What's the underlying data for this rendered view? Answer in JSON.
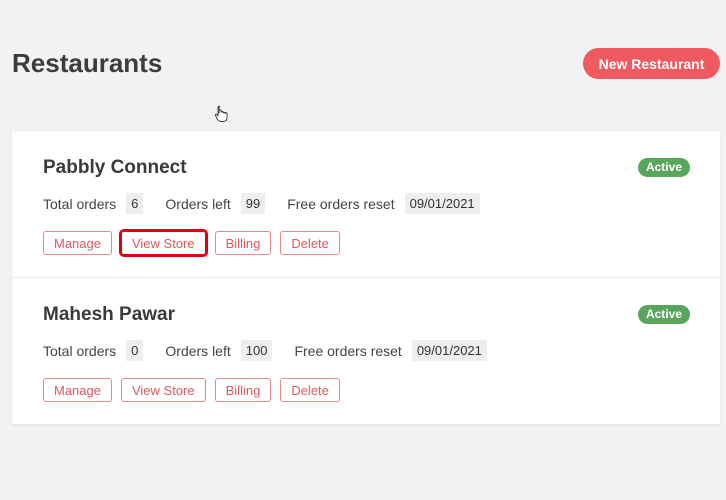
{
  "header": {
    "title": "Restaurants",
    "new_button": "New Restaurant"
  },
  "restaurants": [
    {
      "name": "Pabbly Connect",
      "status": "Active",
      "total_orders_label": "Total orders",
      "total_orders": "6",
      "orders_left_label": "Orders left",
      "orders_left": "99",
      "reset_label": "Free orders reset",
      "reset_date": "09/01/2021",
      "actions": [
        "Manage",
        "View Store",
        "Billing",
        "Delete"
      ]
    },
    {
      "name": "Mahesh Pawar",
      "status": "Active",
      "total_orders_label": "Total orders",
      "total_orders": "0",
      "orders_left_label": "Orders left",
      "orders_left": "100",
      "reset_label": "Free orders reset",
      "reset_date": "09/01/2021",
      "actions": [
        "Manage",
        "View Store",
        "Billing",
        "Delete"
      ]
    }
  ],
  "colors": {
    "accent": "#ee5a5f",
    "status_active": "#58a55c",
    "highlight": "#e00010"
  },
  "icons": {
    "cursor": "hand-pointer-icon"
  }
}
